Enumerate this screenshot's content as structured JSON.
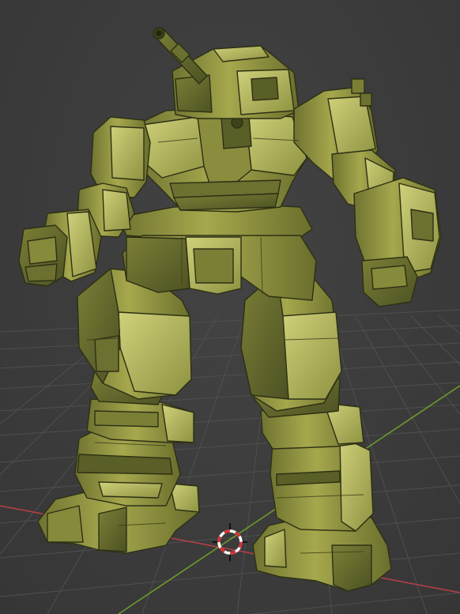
{
  "viewport": {
    "background_color": "#3d3d3d",
    "grid_color": "#4f4f4f",
    "x_axis_color": "#b23e48",
    "y_axis_color": "#6d9a2c"
  },
  "model": {
    "type": "mech robot",
    "material_color": "#9b9d46",
    "shadow_color": "#4d5223",
    "highlight_color": "#d8da86",
    "edge_color": "#2d3014"
  },
  "cursor": {
    "icon": "3d-cursor-icon",
    "ring_colors": [
      "#d33333",
      "#ffffff"
    ]
  }
}
